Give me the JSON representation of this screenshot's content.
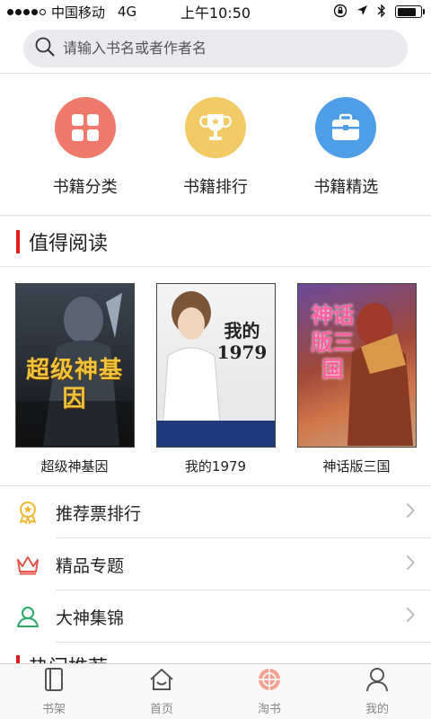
{
  "status_bar": {
    "carrier": "中国移动",
    "network": "4G",
    "time": "上午10:50",
    "battery_level": 0.8
  },
  "search": {
    "placeholder": "请输入书名或者作者名"
  },
  "categories": [
    {
      "label": "书籍分类",
      "icon": "grid-icon",
      "color": "#ef7a6c"
    },
    {
      "label": "书籍排行",
      "icon": "trophy-icon",
      "color": "#f2cb66"
    },
    {
      "label": "书籍精选",
      "icon": "briefcase-icon",
      "color": "#4d9ee6"
    }
  ],
  "recommend": {
    "title": "值得阅读",
    "books": [
      {
        "title": "超级神基因",
        "cover_text": "超级神基因"
      },
      {
        "title": "我的1979",
        "cover_text": "我的1979"
      },
      {
        "title": "神话版三国",
        "cover_text": "神话版三国"
      }
    ]
  },
  "menu": [
    {
      "label": "推荐票排行",
      "icon": "medal-icon",
      "color": "#f2b633"
    },
    {
      "label": "精品专题",
      "icon": "crown-icon",
      "color": "#e4544a"
    },
    {
      "label": "大神集锦",
      "icon": "user-icon",
      "color": "#2ea86a"
    }
  ],
  "hot": {
    "title": "热门推荐"
  },
  "tabbar": {
    "items": [
      {
        "label": "书架",
        "icon": "bookshelf-icon"
      },
      {
        "label": "首页",
        "icon": "home-icon"
      },
      {
        "label": "淘书",
        "icon": "compass-icon",
        "active_color": "#f07060"
      },
      {
        "label": "我的",
        "icon": "profile-icon"
      }
    ]
  },
  "colors": {
    "accent_red": "#e02020"
  }
}
